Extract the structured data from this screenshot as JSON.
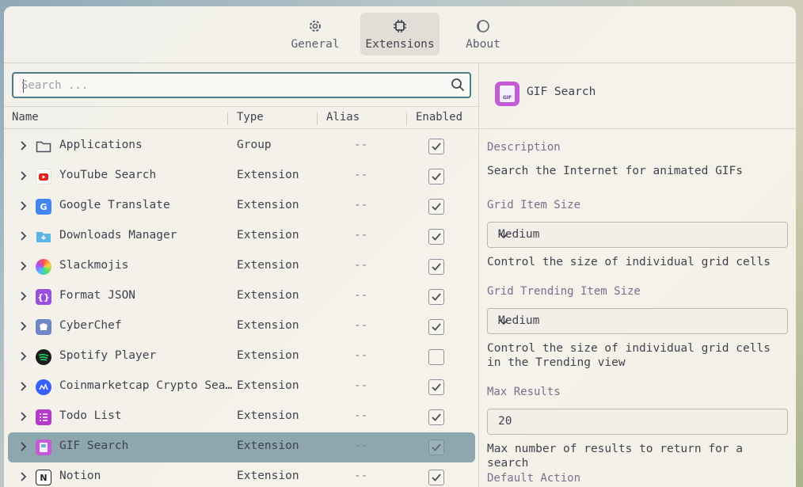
{
  "tabs": [
    {
      "label": "General",
      "icon": "gear-icon"
    },
    {
      "label": "Extensions",
      "icon": "chip-icon"
    },
    {
      "label": "About",
      "icon": "moon-icon"
    }
  ],
  "search": {
    "placeholder": "Search ..."
  },
  "table": {
    "headers": [
      "Name",
      "Type",
      "Alias",
      "Enabled"
    ],
    "rows": [
      {
        "name": "Applications",
        "type": "Group",
        "alias": "--",
        "enabled": true,
        "icon": "folder-icon"
      },
      {
        "name": "YouTube Search",
        "type": "Extension",
        "alias": "--",
        "enabled": true,
        "icon": "youtube-icon"
      },
      {
        "name": "Google Translate",
        "type": "Extension",
        "alias": "--",
        "enabled": true,
        "icon": "google-translate-icon"
      },
      {
        "name": "Downloads Manager",
        "type": "Extension",
        "alias": "--",
        "enabled": true,
        "icon": "download-folder-icon"
      },
      {
        "name": "Slackmojis",
        "type": "Extension",
        "alias": "--",
        "enabled": true,
        "icon": "party-parrot-icon"
      },
      {
        "name": "Format JSON",
        "type": "Extension",
        "alias": "--",
        "enabled": true,
        "icon": "braces-icon"
      },
      {
        "name": "CyberChef",
        "type": "Extension",
        "alias": "--",
        "enabled": true,
        "icon": "chef-hat-icon"
      },
      {
        "name": "Spotify Player",
        "type": "Extension",
        "alias": "--",
        "enabled": false,
        "icon": "spotify-icon"
      },
      {
        "name": "Coinmarketcap Crypto Sea…",
        "type": "Extension",
        "alias": "--",
        "enabled": true,
        "icon": "coinmarketcap-icon"
      },
      {
        "name": "Todo List",
        "type": "Extension",
        "alias": "--",
        "enabled": true,
        "icon": "checklist-icon"
      },
      {
        "name": "GIF Search",
        "type": "Extension",
        "alias": "--",
        "enabled": true,
        "icon": "gif-icon",
        "selected": true
      },
      {
        "name": "Notion",
        "type": "Extension",
        "alias": "--",
        "enabled": true,
        "icon": "notion-icon"
      }
    ]
  },
  "detail": {
    "title": "GIF Search",
    "description_label": "Description",
    "description": "Search the Internet for animated GIFs",
    "grid_item_size": {
      "label": "Grid Item Size",
      "value": "Medium",
      "help": "Control the size of individual grid cells"
    },
    "grid_trending_item_size": {
      "label": "Grid Trending Item Size",
      "value": "Medium",
      "help": "Control the size of individual grid cells in the Trending view"
    },
    "max_results": {
      "label": "Max Results",
      "value": "20",
      "help": "Max number of results to return for a search"
    },
    "default_action": {
      "label": "Default Action"
    }
  },
  "colors": {
    "accent": "#4b7f86",
    "selected_row": "#8ea6ad",
    "label": "#7a6f8f"
  }
}
